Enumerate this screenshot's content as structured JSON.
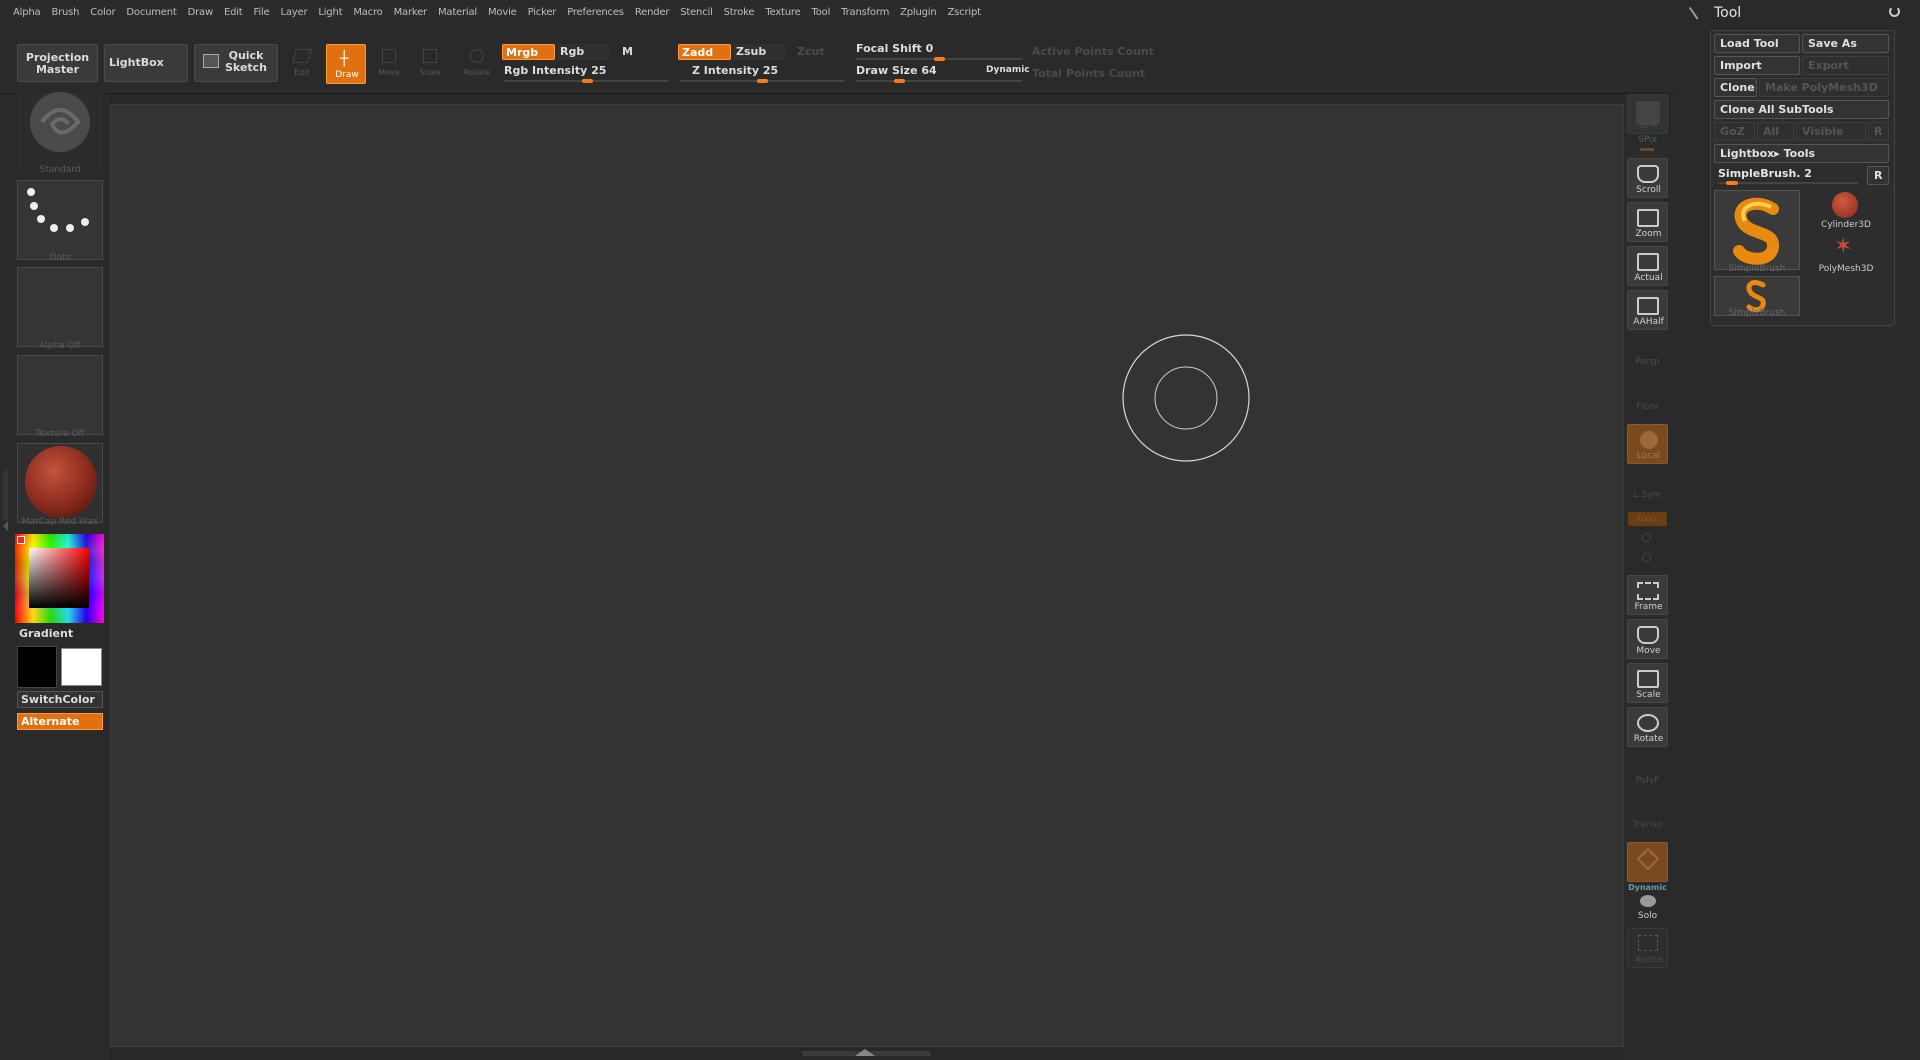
{
  "menu": [
    "Alpha",
    "Brush",
    "Color",
    "Document",
    "Draw",
    "Edit",
    "File",
    "Layer",
    "Light",
    "Macro",
    "Marker",
    "Material",
    "Movie",
    "Picker",
    "Preferences",
    "Render",
    "Stencil",
    "Stroke",
    "Texture",
    "Tool",
    "Transform",
    "Zplugin",
    "Zscript"
  ],
  "shelf": {
    "projection_master": [
      "Projection",
      "Master"
    ],
    "lightbox": "LightBox",
    "quick_sketch": [
      "Quick",
      "Sketch"
    ],
    "edit": "Edit",
    "draw": "Draw",
    "move": "Move",
    "scale": "Scale",
    "rotate": "Rotate",
    "mrgb": "Mrgb",
    "rgb": "Rgb",
    "m": "M",
    "zadd": "Zadd",
    "zsub": "Zsub",
    "zcut": "Zcut",
    "rgb_intensity": "Rgb Intensity 25",
    "z_intensity": "Z Intensity 25",
    "focal_shift": "Focal Shift 0",
    "draw_size": "Draw Size 64",
    "dynamic": "Dynamic",
    "active_points": "Active Points Count",
    "total_points": "Total Points Count",
    "values": {
      "rgb_intensity": 25,
      "z_intensity": 25,
      "focal_shift": 0,
      "draw_size": 64
    }
  },
  "left": {
    "brush": "Standard",
    "stroke": "Dots",
    "alpha": "Alpha Off",
    "texture": "Texture Off",
    "material": "MatCap Red Wax",
    "gradient": "Gradient",
    "switch_color": "SwitchColor",
    "alternate": "Alternate",
    "colors": {
      "primary": "#000000",
      "secondary": "#ffffff",
      "material": "#8a2a1c",
      "accent": "#e07010"
    }
  },
  "dock": {
    "bpr": "BPR",
    "spix": "SPix",
    "scroll": "Scroll",
    "zoom": "Zoom",
    "actual": "Actual",
    "aahalf": "AAHalf",
    "persp": "Persp",
    "floor": "Floor",
    "local": "Local",
    "lsym": "L.Sym",
    "xyz": "Gxyz",
    "frame": "Frame",
    "move": "Move",
    "scale": "Scale",
    "rotate": "Rotate",
    "polyf": "PolyF",
    "transp": "Transp",
    "ghost": "Ghost",
    "dynamic": "Dynamic",
    "solo": "Solo",
    "xpose": "Xpose"
  },
  "tool": {
    "title": "Tool",
    "load_tool": "Load Tool",
    "save_as": "Save As",
    "import": "Import",
    "export": "Export",
    "clone": "Clone",
    "make_polymesh": "Make PolyMesh3D",
    "clone_all": "Clone All SubTools",
    "goz": "GoZ",
    "all": "All",
    "visible": "Visible",
    "r": "R",
    "lightbox_tools": "Lightbox▸ Tools",
    "current": "SimpleBrush. 2",
    "r2": "R",
    "items": [
      "SimpleBrush",
      "Cylinder3D",
      "PolyMesh3D",
      "SimpleBrush"
    ]
  }
}
